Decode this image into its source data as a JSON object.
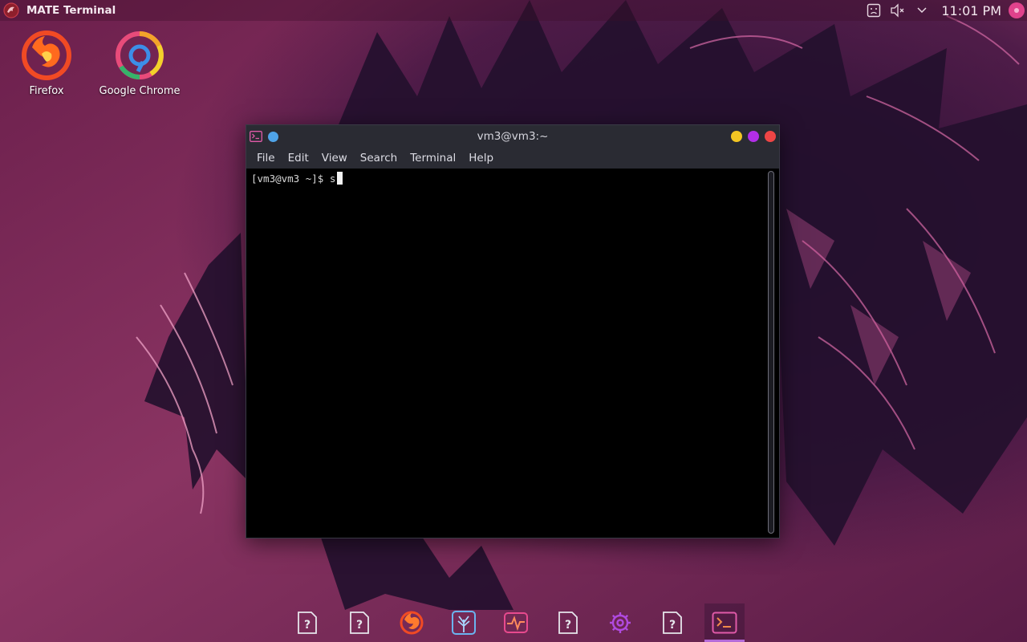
{
  "top_panel": {
    "active_app": "MATE Terminal",
    "tray_icons": [
      "network-offline-icon",
      "volume-muted-icon",
      "chevron-down-icon"
    ],
    "clock": "11:01 PM"
  },
  "desktop": {
    "icons": [
      {
        "label": "Firefox",
        "icon": "firefox-icon"
      },
      {
        "label": "Google Chrome",
        "icon": "chrome-icon"
      }
    ]
  },
  "terminal": {
    "title": "vm3@vm3:~",
    "menu": [
      "File",
      "Edit",
      "View",
      "Search",
      "Terminal",
      "Help"
    ],
    "prompt": "[vm3@vm3 ~]$ ",
    "typed": "s",
    "buttons": [
      {
        "name": "minimize",
        "color": "#f3c623"
      },
      {
        "name": "maximize",
        "color": "#b22ee8"
      },
      {
        "name": "close",
        "color": "#ee4545"
      }
    ]
  },
  "dock": {
    "items": [
      {
        "icon": "unknown-app-icon",
        "active": false
      },
      {
        "icon": "unknown-app-icon",
        "active": false
      },
      {
        "icon": "firefox-icon",
        "active": false
      },
      {
        "icon": "tree-app-icon",
        "active": false
      },
      {
        "icon": "system-monitor-icon",
        "active": false
      },
      {
        "icon": "unknown-app-icon",
        "active": false
      },
      {
        "icon": "settings-gear-icon",
        "active": false
      },
      {
        "icon": "unknown-app-icon",
        "active": false
      },
      {
        "icon": "terminal-icon",
        "active": true
      }
    ]
  },
  "colors": {
    "accent": "#b46ad8",
    "wallpaper_base": "#7a2c58",
    "terminal_bg": "#000000",
    "titlebar_bg": "#2a2b33"
  }
}
